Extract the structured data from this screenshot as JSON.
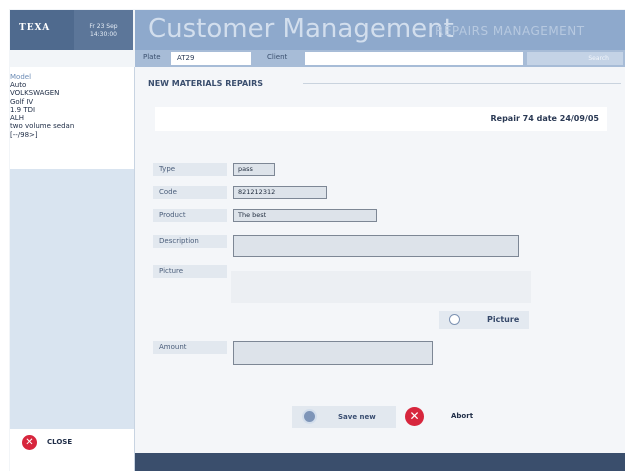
{
  "brand": {
    "logo": "TEXA",
    "date_line1": "Fr 23 Sep",
    "date_line2": "14:30:00"
  },
  "header": {
    "title": "Customer Management",
    "subtitle": "REPAIRS MANAGEMENT"
  },
  "plate_bar": {
    "plate_label": "Plate",
    "plate_value": "AT29",
    "client_label": "Client",
    "client_value": "",
    "right_text": "Search"
  },
  "sidebar": {
    "model_header": "Model",
    "lines": [
      "Auto",
      "VOLKSWAGEN",
      "Golf IV",
      "1.9 TDI",
      "ALH",
      "two volume sedan",
      "[--/98>]"
    ],
    "close_label": "CLOSE"
  },
  "form": {
    "section_title": "NEW MATERIALS REPAIRS",
    "repair_info": "Repair 74 date 24/09/05",
    "fields": {
      "type": {
        "label": "Type",
        "value": "pass"
      },
      "code": {
        "label": "Code",
        "value": "821212312"
      },
      "product": {
        "label": "Product",
        "value": "The best"
      },
      "description": {
        "label": "Description",
        "value": ""
      },
      "picture": {
        "label": "Picture"
      },
      "amount": {
        "label": "Amount",
        "value": ""
      }
    },
    "picture_button": "Picture",
    "save_button": "Save new",
    "abort_button": "Abort"
  }
}
